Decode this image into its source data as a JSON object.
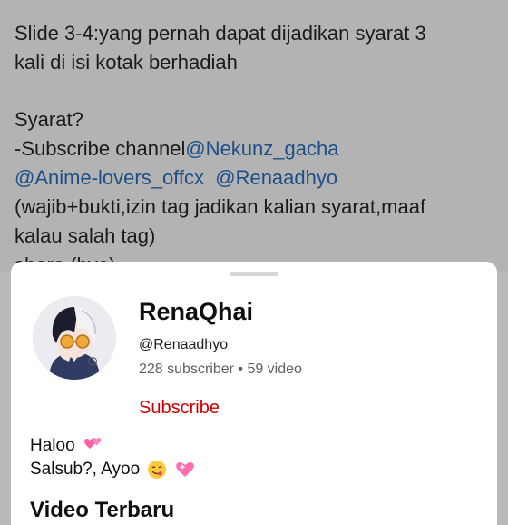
{
  "post": {
    "line1": "Slide 3-4:yang pernah dapat dijadikan syarat 3",
    "line2": "kali di isi kotak berhadiah",
    "syarat_heading": "Syarat?",
    "subscribe_prefix": "-Subscribe channel",
    "mention1": "@Nekunz_gacha",
    "mention2": "@Anime-lovers_offcx",
    "mention3": "@Renaadhyo",
    "note1": "(wajib+bukti,izin tag jadikan kalian syarat,maaf",
    "note2": "kalau salah tag)",
    "cut_line": "share (bye)"
  },
  "channel": {
    "name": "RenaQhai",
    "handle": "@Renaadhyo",
    "stats": "228 subscriber • 59 video",
    "subscribe_label": "Subscribe",
    "avatar_icon": "anime-avatar",
    "desc_line1": "Haloo",
    "desc_line2": "Salsub?, Ayoo",
    "emoji1": "two-hearts",
    "emoji2": "savoring-face",
    "emoji3": "sparkling-heart"
  },
  "section": {
    "title": "Video Terbaru"
  },
  "colors": {
    "subscribe": "#cc0000",
    "mention": "#1d4f86",
    "overlay": "#b3b3b3"
  }
}
